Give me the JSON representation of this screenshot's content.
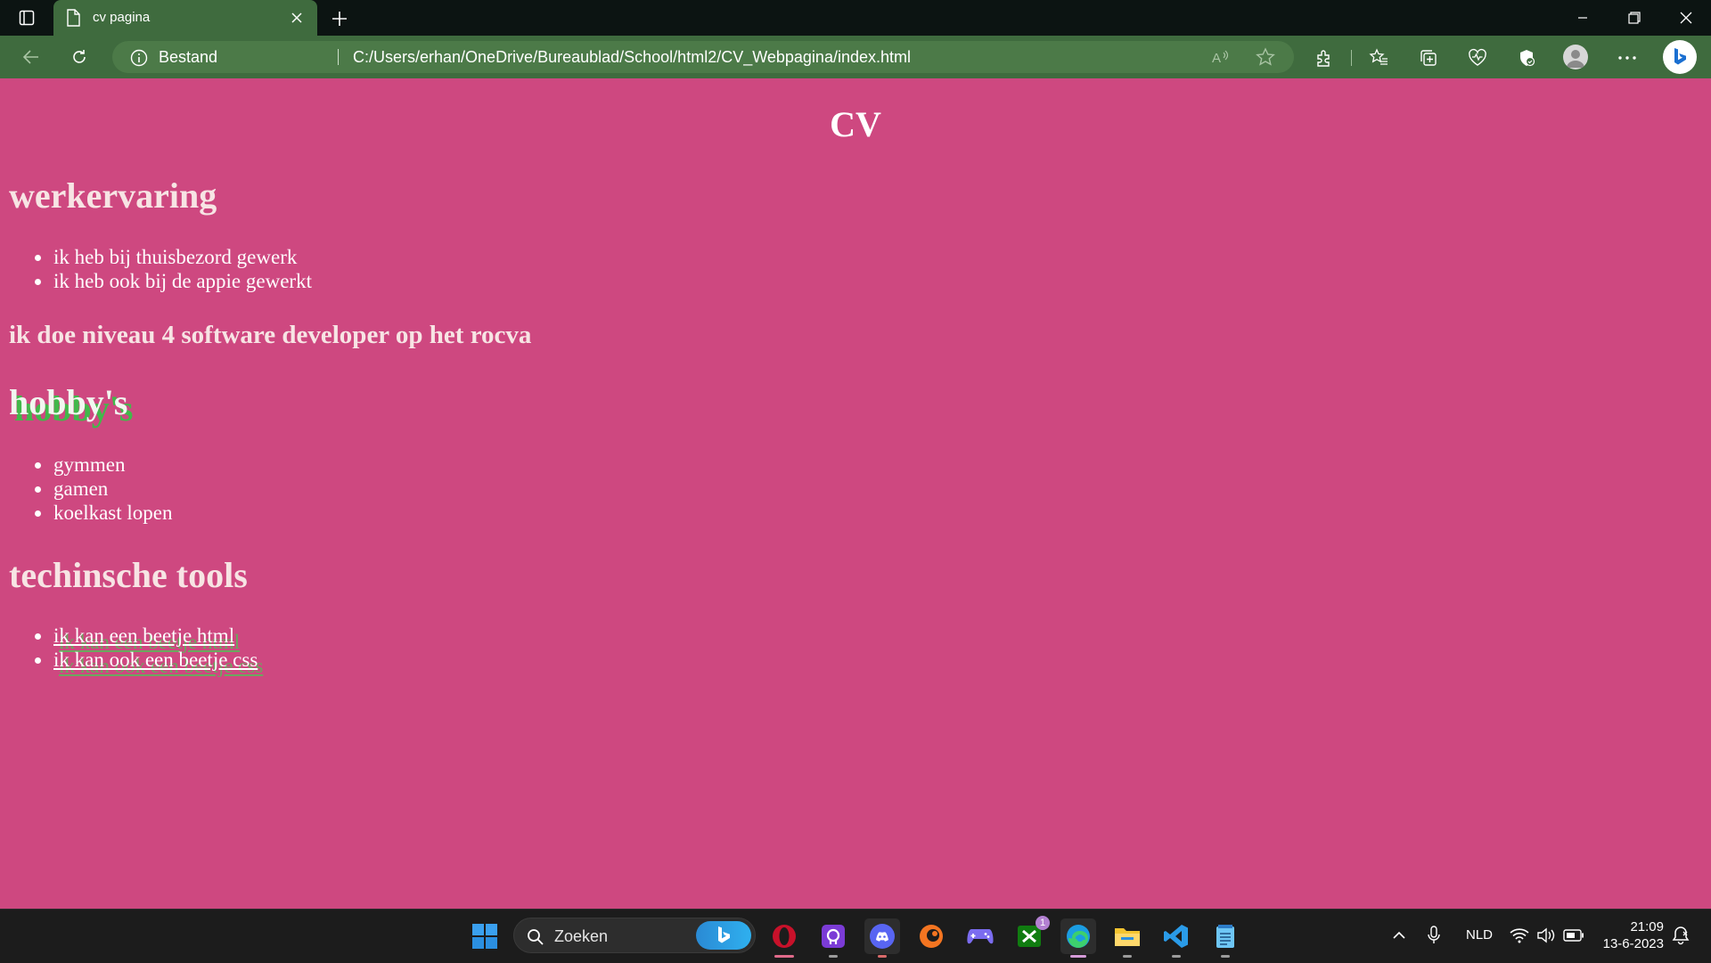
{
  "browser": {
    "tab_title": "cv pagina",
    "address_label": "Bestand",
    "url": "C:/Users/erhan/OneDrive/Bureaublad/School/html2/CV_Webpagina/index.html"
  },
  "page": {
    "title": "CV",
    "sections": {
      "work": {
        "heading": "werkervaring",
        "items": [
          "ik heb bij thuisbezord gewerk",
          "ik heb ook bij de appie gewerkt"
        ]
      },
      "education": "ik doe niveau 4 software developer op het rocva",
      "hobbies": {
        "heading": "hobby's",
        "items": [
          "gymmen",
          "gamen",
          "koelkast lopen"
        ]
      },
      "tools": {
        "heading": "techinsche tools",
        "items": [
          "ik kan een beetje html",
          "ik kan ook een beetje css"
        ]
      }
    }
  },
  "taskbar": {
    "search_placeholder": "Zoeken",
    "xbox_badge": "1",
    "language": "NLD",
    "time": "21:09",
    "date": "13-6-2023"
  },
  "colors": {
    "page_background": "#ce4880",
    "browser_toolbar": "#3f6b3e",
    "hobby_heading_shadow": "#42b84a"
  }
}
